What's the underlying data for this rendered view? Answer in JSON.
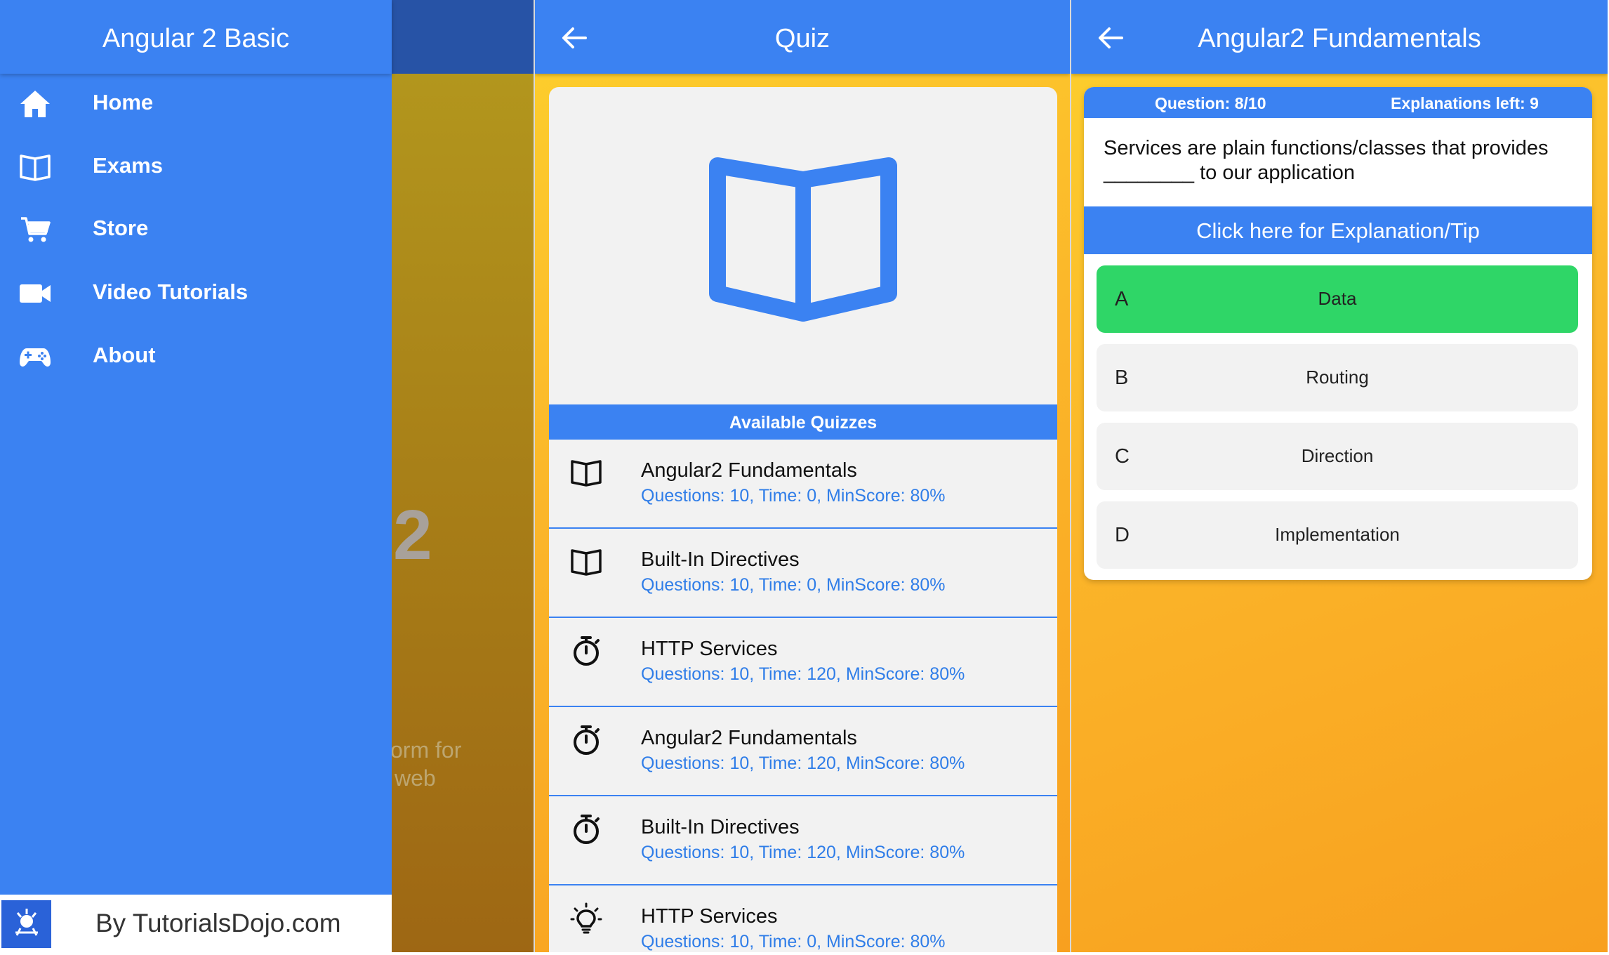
{
  "drawer": {
    "title": "Angular 2 Basic",
    "items": [
      {
        "label": "Home",
        "icon": "home-icon"
      },
      {
        "label": "Exams",
        "icon": "book-icon"
      },
      {
        "label": "Store",
        "icon": "cart-icon"
      },
      {
        "label": "Video Tutorials",
        "icon": "video-camera-icon"
      },
      {
        "label": "About",
        "icon": "gamepad-icon"
      }
    ],
    "footer_text": "By TutorialsDojo.com"
  },
  "background_page": {
    "big_text": "2",
    "line1": "orm for",
    "line2": "web"
  },
  "quiz_screen": {
    "title": "Quiz",
    "section_title": "Available Quizzes",
    "quizzes": [
      {
        "title": "Angular2 Fundamentals",
        "meta": "Questions: 10, Time: 0, MinScore: 80%",
        "icon": "book-icon"
      },
      {
        "title": "Built-In Directives",
        "meta": "Questions: 10, Time: 0, MinScore: 80%",
        "icon": "book-icon"
      },
      {
        "title": "HTTP Services",
        "meta": "Questions: 10, Time: 120, MinScore: 80%",
        "icon": "stopwatch-icon"
      },
      {
        "title": "Angular2 Fundamentals",
        "meta": "Questions: 10, Time: 120, MinScore: 80%",
        "icon": "stopwatch-icon"
      },
      {
        "title": "Built-In Directives",
        "meta": "Questions: 10, Time: 120, MinScore: 80%",
        "icon": "stopwatch-icon"
      },
      {
        "title": "HTTP Services",
        "meta": "Questions: 10, Time: 0, MinScore: 80%",
        "icon": "lightbulb-icon"
      }
    ]
  },
  "question_screen": {
    "title": "Angular2 Fundamentals",
    "question_number": "Question: 8/10",
    "explanations_left": "Explanations left: 9",
    "question_text": "Services are plain functions/classes that provides ________ to our application",
    "explain_button": "Click here for Explanation/Tip",
    "answers": [
      {
        "letter": "A",
        "text": "Data",
        "state": "correct"
      },
      {
        "letter": "B",
        "text": "Routing",
        "state": "default"
      },
      {
        "letter": "C",
        "text": "Direction",
        "state": "default"
      },
      {
        "letter": "D",
        "text": "Implementation",
        "state": "default"
      }
    ]
  },
  "colors": {
    "primary_blue": "#3b82f2",
    "correct_green": "#2fd667",
    "background_gradient_start": "#fdd02d",
    "background_gradient_end": "#f8a01f",
    "link_blue": "#2f7de8"
  }
}
